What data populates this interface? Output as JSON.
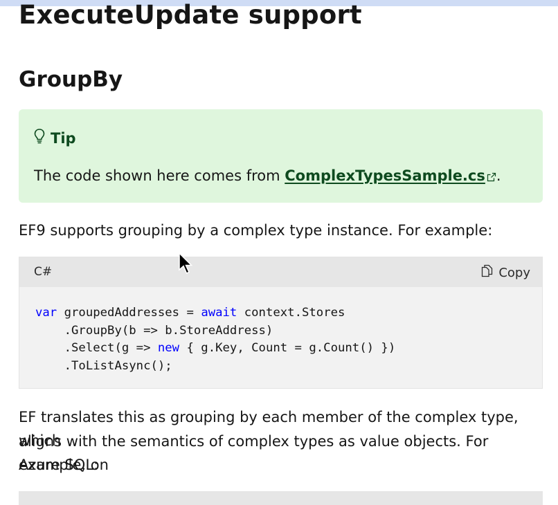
{
  "page": {
    "title": "ExecuteUpdate support",
    "section_heading": "GroupBy"
  },
  "tip": {
    "icon": "lightbulb-icon",
    "title": "Tip",
    "text_before": "The code shown here comes from ",
    "link_text": "ComplexTypesSample.cs",
    "text_after": "."
  },
  "intro_paragraph": "EF9 supports grouping by a complex type instance. For example:",
  "code_block": {
    "language": "C#",
    "copy_label": "Copy",
    "lines": [
      [
        {
          "t": "var",
          "kw": true
        },
        {
          "t": " groupedAddresses = "
        },
        {
          "t": "await",
          "kw": true
        },
        {
          "t": " context.Stores"
        }
      ],
      [
        {
          "t": "    .GroupBy(b => b.StoreAddress)"
        }
      ],
      [
        {
          "t": "    .Select(g => "
        },
        {
          "t": "new",
          "kw": true
        },
        {
          "t": " { g.Key, Count = g.Count() })"
        }
      ],
      [
        {
          "t": "    .ToListAsync();"
        }
      ]
    ]
  },
  "followup_paragraph": {
    "line1": "EF translates this as grouping by each member of the complex type, which",
    "line2": "aligns with the semantics of complex types as value objects. For example, on",
    "line3": "Azure SQL:"
  },
  "colors": {
    "tip_background": "#dff6dd",
    "tip_accent": "#0e4a1f",
    "keyword": "#0101fd",
    "code_background": "#f2f2f2"
  }
}
